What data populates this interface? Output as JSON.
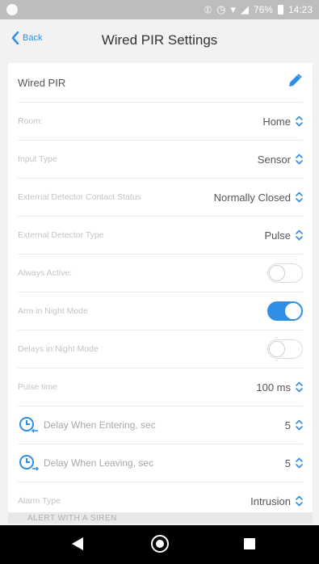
{
  "status_bar": {
    "battery": "76%",
    "time": "14:23"
  },
  "header": {
    "back_label": "Back",
    "title": "Wired PIR Settings"
  },
  "device": {
    "name": "Wired PIR"
  },
  "settings": {
    "room": {
      "label": "Room:",
      "value": "Home"
    },
    "input_type": {
      "label": "Input Type",
      "value": "Sensor"
    },
    "contact_status": {
      "label": "External Detector Contact Status",
      "value": "Normally Closed"
    },
    "detector_type": {
      "label": "External Detector Type",
      "value": "Pulse"
    },
    "always_active": {
      "label": "Always Active:",
      "on": false
    },
    "arm_night": {
      "label": "Arm in Night Mode",
      "on": true
    },
    "delays_night": {
      "label": "Delays in Night Mode",
      "on": false
    },
    "pulse_time": {
      "label": "Pulse time",
      "value": "100 ms"
    },
    "delay_entering": {
      "label": "Delay When Entering, sec",
      "value": "5"
    },
    "delay_leaving": {
      "label": "Delay When Leaving, sec",
      "value": "5"
    },
    "alarm_type": {
      "label": "Alarm Type",
      "value": "Intrusion"
    }
  },
  "section": {
    "alert_siren": "ALERT WITH A SIREN"
  },
  "colors": {
    "accent": "#2f8fe6",
    "toggle_on": "#2f8fe6"
  },
  "icons": {
    "edit": "pencil-icon",
    "back": "chevron-left-icon",
    "stepper": "up-down-chevron-icon",
    "timer_enter": "timer-enter-icon",
    "timer_leave": "timer-leave-icon"
  }
}
